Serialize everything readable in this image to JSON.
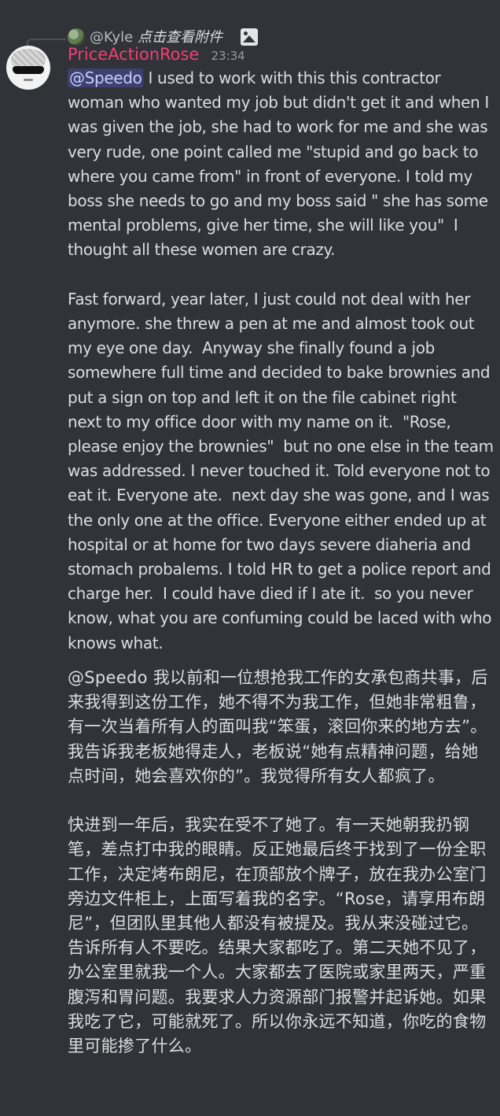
{
  "reply": {
    "username": "@Kyle",
    "note": "点击查看附件",
    "avatar_icon": "user-avatar-small",
    "attachment_icon": "image-icon"
  },
  "message": {
    "username": "PriceActionRose",
    "timestamp": "23:34",
    "avatar_icon": "user-avatar-sunglasses",
    "mention": "@Speedo",
    "body_en": " I used to work with this this contractor woman who wanted my job but didn't get it and when I was given the job, she had to work for me and she was very rude, one point called me \"stupid and go back to where you came from\" in front of everyone. I told my boss she needs to go and my boss said \" she has some mental problems, give her time, she will like you\"  I thought all these women are crazy.\n\nFast forward, year later, I just could not deal with her anymore. she threw a pen at me and almost took out my eye one day.  Anyway she finally found a job somewhere full time and decided to bake brownies and put a sign on top and left it on the file cabinet right next to my office door with my name on it.  \"Rose, please enjoy the brownies\"  but no one else in the team was addressed. I never touched it. Told everyone not to eat it. Everyone ate.  next day she was gone, and I was the only one at the office. Everyone either ended up at hospital or at home for two days severe diaheria and stomach probalems. I told HR to get a police report and charge her.  I could have died if I ate it.  so you never know, what you are confuming could be laced with who knows what.",
    "body_zh": "@Speedo 我以前和一位想抢我工作的女承包商共事，后来我得到这份工作，她不得不为我工作，但她非常粗鲁，有一次当着所有人的面叫我“笨蛋，滚回你来的地方去”。我告诉我老板她得走人，老板说“她有点精神问题，给她点时间，她会喜欢你的”。我觉得所有女人都疯了。\n\n快进到一年后，我实在受不了她了。有一天她朝我扔钢笔，差点打中我的眼睛。反正她最后终于找到了一份全职工作，决定烤布朗尼，在顶部放个牌子，放在我办公室门旁边文件柜上，上面写着我的名字。“Rose，请享用布朗尼”，但团队里其他人都没有被提及。我从来没碰过它。告诉所有人不要吃。结果大家都吃了。第二天她不见了，办公室里就我一个人。大家都去了医院或家里两天，严重腹泻和胃问题。我要求人力资源部门报警并起诉她。如果我吃了它，可能就死了。所以你永远不知道，你吃的食物里可能掺了什么。"
  }
}
